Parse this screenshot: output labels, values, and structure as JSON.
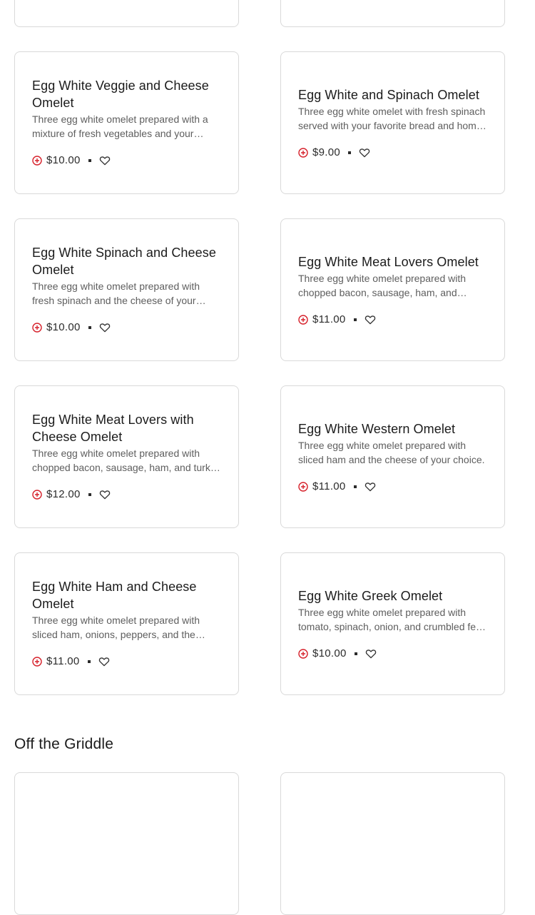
{
  "menu_items": [
    {
      "name": "Egg White Veggie and Cheese Omelet",
      "description": "Three egg white omelet prepared with a mixture of fresh vegetables and your choice of cheese.",
      "price": "$10.00"
    },
    {
      "name": "Egg White and Spinach Omelet",
      "description": "Three egg white omelet with fresh spinach served with your favorite bread and home fries.",
      "price": "$9.00"
    },
    {
      "name": "Egg White Spinach and Cheese Omelet",
      "description": "Three egg white omelet prepared with fresh spinach and the cheese of your choice.",
      "price": "$10.00"
    },
    {
      "name": "Egg White Meat Lovers Omelet",
      "description": "Three egg white omelet prepared with chopped bacon, sausage, ham, and turkey.",
      "price": "$11.00"
    },
    {
      "name": "Egg White Meat Lovers with Cheese Omelet",
      "description": "Three egg white omelet prepared with chopped bacon, sausage, ham, and turkey with cheese.",
      "price": "$12.00"
    },
    {
      "name": "Egg White Western Omelet",
      "description": "Three egg white omelet prepared with sliced ham and the cheese of your choice.",
      "price": "$11.00"
    },
    {
      "name": "Egg White Ham and Cheese Omelet",
      "description": "Three egg white omelet prepared with sliced ham, onions, peppers, and the cheese of your choice.",
      "price": "$11.00"
    },
    {
      "name": "Egg White Greek Omelet",
      "description": "Three egg white omelet prepared with tomato, spinach, onion, and crumbled feta cheese.",
      "price": "$10.00"
    }
  ],
  "next_section": {
    "heading": "Off the Griddle"
  },
  "icons": {
    "add": "add-circle-icon",
    "favorite": "heart-outline-icon"
  },
  "colors": {
    "accent": "#d6202a",
    "card_border": "#d9d9d9",
    "description_text": "#5e5e5e"
  }
}
